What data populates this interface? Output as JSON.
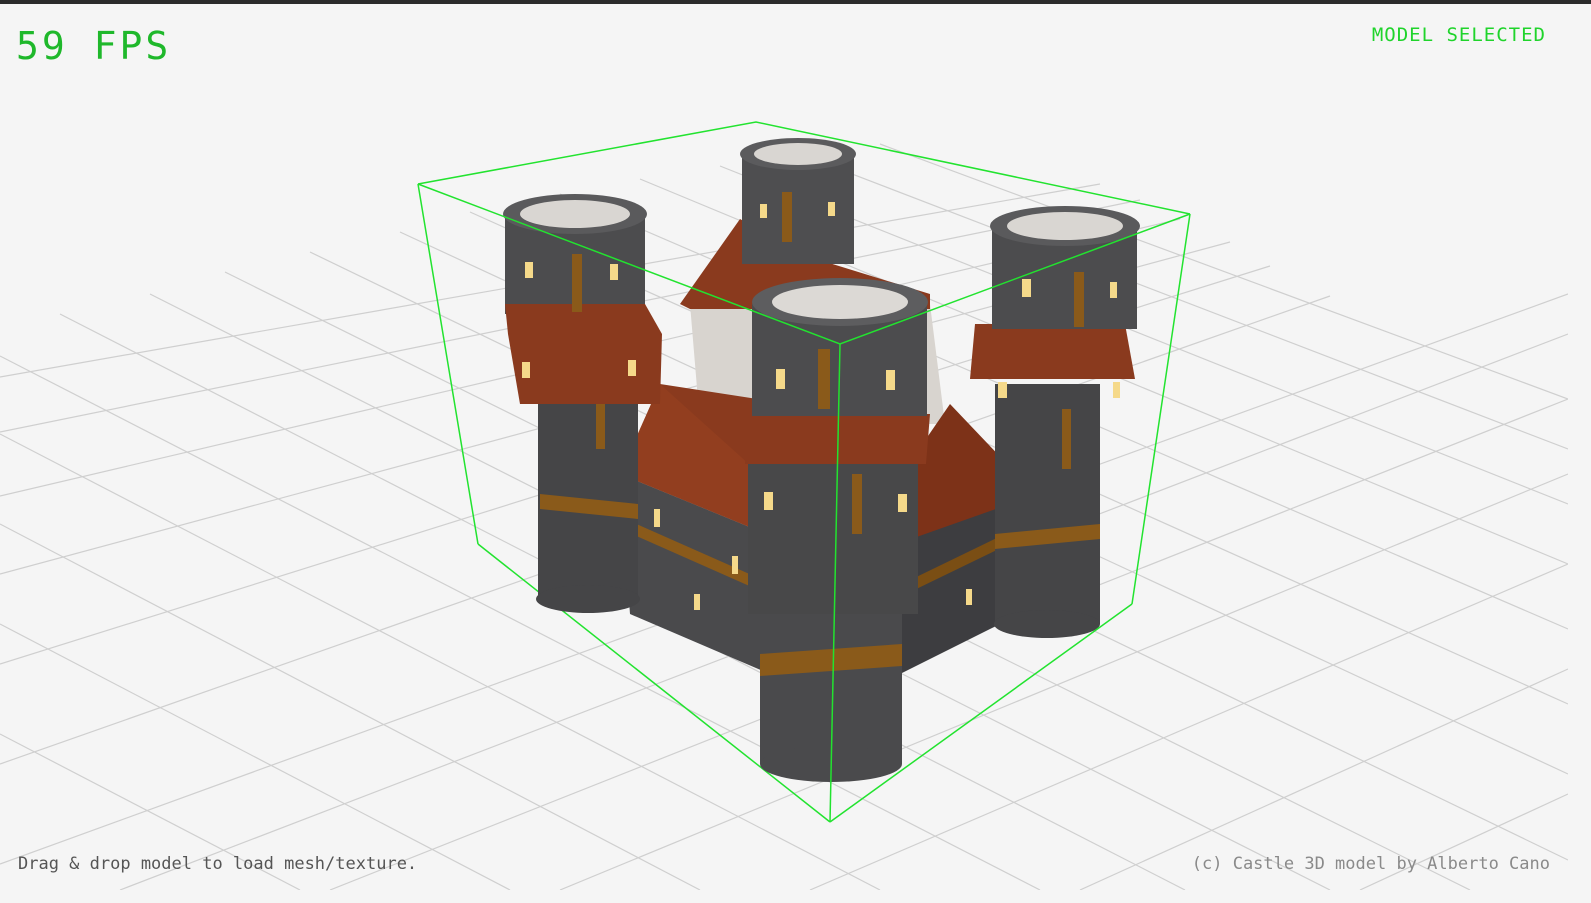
{
  "hud": {
    "fps_text": "59 FPS",
    "status_text": "MODEL SELECTED"
  },
  "footer": {
    "hint_text": "Drag & drop model to load mesh/texture.",
    "credit_text": "(c) Castle 3D model by Alberto Cano"
  },
  "colors": {
    "background": "#f5f5f5",
    "grid": "#c8c8c8",
    "bounding_box": "#1fe02b",
    "hud_text": "#1fb82b",
    "stone": "#4a4a4c",
    "roof": "#8a3a1e",
    "wood_trim": "#8a5a1a",
    "window_glow": "#f5d98a"
  },
  "scene": {
    "model": "castle",
    "selected": true
  }
}
